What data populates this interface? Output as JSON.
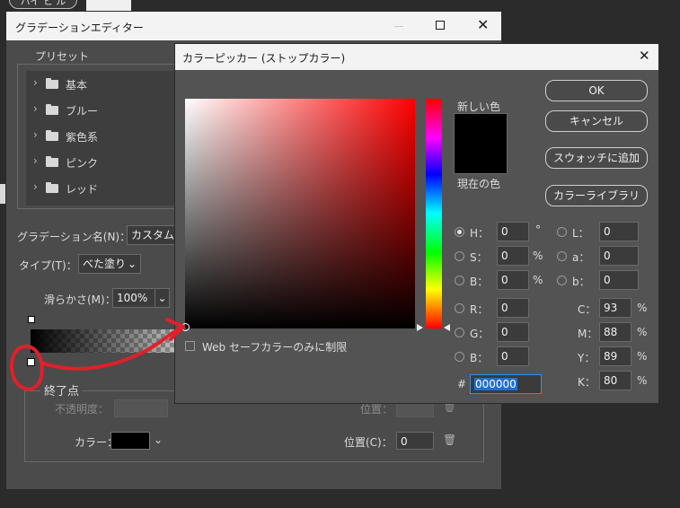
{
  "background_window": {
    "tab_label": "ハイ ヒ ル"
  },
  "gradient_editor": {
    "title": "グラデーションエディター",
    "presets_label": "プリセット",
    "presets": [
      {
        "label": "基本"
      },
      {
        "label": "ブルー"
      },
      {
        "label": "紫色系"
      },
      {
        "label": "ピンク"
      },
      {
        "label": "レッド"
      }
    ],
    "name_label": "グラデーション名(N)：",
    "name_value": "カスタム",
    "type_label": "タイプ(T)：",
    "type_value": "べた塗り",
    "smooth_label": "滑らかさ(M)：",
    "smooth_value": "100%",
    "stops_group": "終了点",
    "opacity_label": "不透明度：",
    "position_label_top": "位置：",
    "color_label": "カラー：",
    "position_label": "位置(C)：",
    "position_value": "0"
  },
  "color_picker": {
    "title": "カラーピッカー (ストップカラー)",
    "new_label": "新しい色",
    "current_label": "現在の色",
    "buttons": {
      "ok": "OK",
      "cancel": "キャンセル",
      "add_swatch": "スウォッチに追加",
      "libraries": "カラーライブラリ"
    },
    "web_safe_label": "Web セーフカラーのみに制限",
    "hsb": [
      {
        "key": "H：",
        "value": "0",
        "unit": "°"
      },
      {
        "key": "S：",
        "value": "0",
        "unit": "%"
      },
      {
        "key": "B：",
        "value": "0",
        "unit": "%"
      }
    ],
    "rgb": [
      {
        "key": "R：",
        "value": "0"
      },
      {
        "key": "G：",
        "value": "0"
      },
      {
        "key": "B：",
        "value": "0"
      }
    ],
    "lab": [
      {
        "key": "L：",
        "value": "0"
      },
      {
        "key": "a：",
        "value": "0"
      },
      {
        "key": "b：",
        "value": "0"
      }
    ],
    "cmyk": [
      {
        "key": "C：",
        "value": "93",
        "unit": "%"
      },
      {
        "key": "M：",
        "value": "88",
        "unit": "%"
      },
      {
        "key": "Y：",
        "value": "89",
        "unit": "%"
      },
      {
        "key": "K：",
        "value": "80",
        "unit": "%"
      }
    ],
    "hex_label": "#",
    "hex_value": "000000"
  },
  "colors": {
    "hue_base": "#ff0000",
    "selected": "#000000",
    "annotation": "#e0202a"
  }
}
